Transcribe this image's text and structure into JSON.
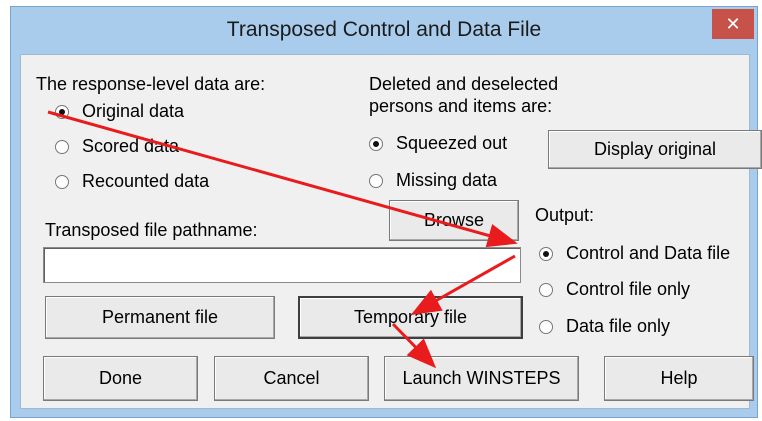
{
  "window": {
    "title": "Transposed Control and Data File",
    "close_glyph": "✕"
  },
  "response_group": {
    "label": "The response-level data are:",
    "options": [
      {
        "label": "Original data",
        "checked": true
      },
      {
        "label": "Scored data",
        "checked": false
      },
      {
        "label": "Recounted data",
        "checked": false
      }
    ]
  },
  "deleted_group": {
    "label_line1": "Deleted and deselected",
    "label_line2": "persons and items are:",
    "options": [
      {
        "label": "Squeezed out",
        "checked": true
      },
      {
        "label": "Missing data",
        "checked": false
      }
    ],
    "display_button": "Display original"
  },
  "pathname": {
    "label": "Transposed file pathname:",
    "value": "",
    "browse_button": "Browse"
  },
  "output_group": {
    "label": "Output:",
    "options": [
      {
        "label": "Control and Data file",
        "checked": true
      },
      {
        "label": "Control file only",
        "checked": false
      },
      {
        "label": "Data file only",
        "checked": false
      }
    ]
  },
  "file_buttons": {
    "permanent": "Permanent file",
    "temporary": "Temporary file"
  },
  "bottom_buttons": {
    "done": "Done",
    "cancel": "Cancel",
    "launch": "Launch WINSTEPS",
    "help": "Help"
  },
  "colors": {
    "annotation_arrow": "#e81c1c",
    "titlebar": "#a9ccec",
    "close_button": "#c7524a"
  }
}
